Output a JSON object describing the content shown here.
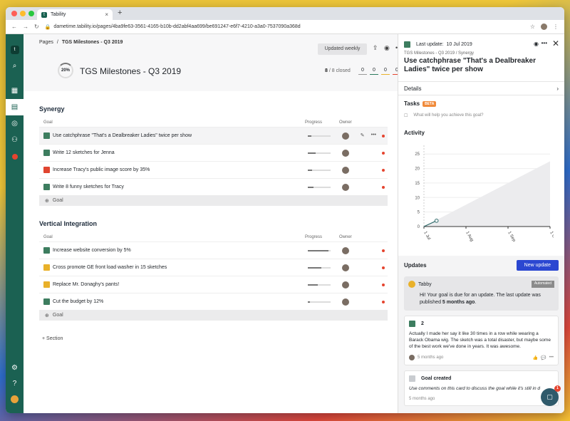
{
  "browser": {
    "tab_title": "Tability",
    "url": "dametime.tability.io/pages/4ba9fe63-3561-4165-b10b-dd2abf4aa699/be691247-e6f7-4210-a3a0-7537090a368d"
  },
  "crumbs": {
    "pages": "Pages",
    "sep": "/",
    "current": "TGS Milestones - Q3 2019"
  },
  "header": {
    "updated": "Updated weekly",
    "progress": "20%",
    "title": "TGS Milestones - Q3 2019",
    "closed_count": "8",
    "closed_label": "/ 8 closed",
    "counts": [
      "0",
      "0",
      "0",
      "0"
    ]
  },
  "columns": {
    "goal": "Goal",
    "progress": "Progress",
    "owner": "Owner"
  },
  "sections": [
    {
      "title": "Synergy",
      "goals": [
        {
          "name": "Use catchphrase \"That's a Dealbreaker Ladies\" twice per show",
          "color": "#3d7d5f",
          "progress": 0.15
        },
        {
          "name": "Write 12 sketches for Jenna",
          "color": "#3d7d5f",
          "progress": 0.35
        },
        {
          "name": "Increase Tracy's public image score by 35%",
          "color": "#e04530",
          "progress": 0.2
        },
        {
          "name": "Write 8 funny sketches for Tracy",
          "color": "#3d7d5f",
          "progress": 0.25
        }
      ],
      "add": "Goal"
    },
    {
      "title": "Vertical Integration",
      "goals": [
        {
          "name": "Increase website conversion by 5%",
          "color": "#3d7d5f",
          "progress": 0.9
        },
        {
          "name": "Cross promote GE front load washer in 15 sketches",
          "color": "#e9b12a",
          "progress": 0.6
        },
        {
          "name": "Replace Mr. Donaghy's pants!",
          "color": "#e9b12a",
          "progress": 0.45
        },
        {
          "name": "Cut the budget by 12%",
          "color": "#3d7d5f",
          "progress": 0.1
        }
      ],
      "add": "Goal"
    }
  ],
  "add_section": "+ Section",
  "panel": {
    "last_update": "Last update:",
    "last_update_date": "10 Jul 2019",
    "crumb": "TGS Milestones - Q3 2019 / Synergy",
    "title": "Use catchphrase \"That's a Dealbreaker Ladies\" twice per show",
    "details": "Details",
    "tasks": "Tasks",
    "beta": "BETA",
    "task_placeholder": "What will help you achieve this goal?",
    "activity": "Activity"
  },
  "chart_data": {
    "type": "area",
    "x": [
      "1 Jul",
      "1 Aug",
      "1 Sep",
      "1 Oct"
    ],
    "y_ticks": [
      "0",
      "5",
      "10",
      "15",
      "20",
      "25"
    ],
    "ylim": [
      0,
      28
    ],
    "progress_line": [
      [
        0,
        0
      ],
      [
        0.3,
        2
      ]
    ],
    "target_line": [
      [
        0,
        0
      ],
      [
        3,
        22.5
      ]
    ]
  },
  "updates": {
    "title": "Updates",
    "new": "New update",
    "bot_name": "Tabby",
    "automated": "Automated",
    "bot_text": "Hi! Your goal is due for an update. The last update was published ",
    "bot_bold": "5 months ago",
    "bot_end": ".",
    "u1_score": "2",
    "u1_text": "Actually I made her say it like 30 times in a row while wearing a Barack Obama wig. The sketch was a total disaster, but maybe some of the best work we've done in years. It was awesome.",
    "u1_time": "5 months ago",
    "u2_title": "Goal created",
    "u2_text": "Use comments on this card to discuss the goal while it's still in d",
    "u2_time": "5 months ago",
    "fab_badge": "1"
  }
}
